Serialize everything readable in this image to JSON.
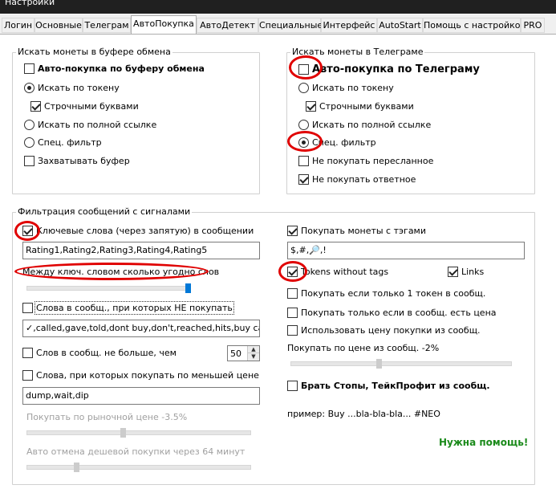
{
  "window": {
    "title": "Настройки"
  },
  "tabs": [
    {
      "label": "Логин"
    },
    {
      "label": "Основные"
    },
    {
      "label": "Телеграм"
    },
    {
      "label": "АвтоПокупка"
    },
    {
      "label": "АвтоДетект"
    },
    {
      "label": "Специальные"
    },
    {
      "label": "Интерфейс"
    },
    {
      "label": "AutoStart"
    },
    {
      "label": "Помощь с настройкой"
    },
    {
      "label": "PRO"
    }
  ],
  "active_tab": "АвтоПокупка",
  "clipboard_group": {
    "title": "Искать монеты в буфере обмена",
    "auto_buy": {
      "label": "Авто-покупка по буферу обмена",
      "checked": false
    },
    "by_token": {
      "label": "Искать по токену",
      "selected": true
    },
    "lowercase": {
      "label": "Строчными буквами",
      "checked": true
    },
    "by_link": {
      "label": "Искать по полной ссылке",
      "selected": false
    },
    "spec_filter": {
      "label": "Спец. фильтр",
      "selected": false
    },
    "capture": {
      "label": "Захватывать буфер",
      "checked": false
    }
  },
  "telegram_group": {
    "title": "Искать монеты в Телеграме",
    "auto_buy": {
      "label": "Авто-покупка по Телеграму",
      "checked": false
    },
    "by_token": {
      "label": "Искать по токену",
      "selected": false
    },
    "lowercase": {
      "label": "Строчными буквами",
      "checked": true
    },
    "by_link": {
      "label": "Искать по полной ссылке",
      "selected": false
    },
    "spec_filter": {
      "label": "Спец. фильтр",
      "selected": true
    },
    "no_forwarded": {
      "label": "Не покупать пересланное",
      "checked": false
    },
    "no_replies": {
      "label": "Не покупать ответное",
      "checked": true
    }
  },
  "filter_group": {
    "title": "Фильтрация сообщений с сигналами",
    "keywords": {
      "label": "Ключевые слова (через запятую) в сообщении",
      "checked": true,
      "value": "Rating1,Rating2,Rating3,Rating4,Rating5"
    },
    "between_label": "Между ключ. словом сколько угодно слов",
    "between_slider": {
      "value": 1.0
    },
    "exclude_words": {
      "label": "Слова в сообщ., при которых НЕ покупать",
      "checked": false,
      "value": "✓,called,gave,told,dont buy,don't,reached,hits,buy call,rep"
    },
    "max_words": {
      "label": "Слов в сообщ. не больше, чем",
      "checked": false,
      "value": "50"
    },
    "lower_price_words": {
      "label": "Слова, при которых покупать по меньшей цене",
      "checked": false,
      "value": "dump,wait,dip"
    },
    "market_price_label": "Покупать по рыночной цене -3.5%",
    "market_price_slider": {
      "value": 0.43
    },
    "auto_cancel_label": "Авто отмена дешевой покупки через 64 минут",
    "auto_cancel_slider": {
      "value": 0.22
    },
    "tags": {
      "label": "Покупать монеты с тэгами",
      "checked": true,
      "value": "$,#,🔎,!"
    },
    "tokens_without_tags": {
      "label": "Tokens without tags",
      "checked": true
    },
    "links": {
      "label": "Links",
      "checked": true
    },
    "only_one_token": {
      "label": "Покупать если только 1 токен в сообщ.",
      "checked": false
    },
    "only_with_price": {
      "label": "Покупать только если в сообщ. есть цена",
      "checked": false
    },
    "use_msg_price": {
      "label": "Использовать цену покупки из сообщ.",
      "checked": false
    },
    "msg_price_label": "Покупать по цене из сообщ. -2%",
    "msg_price_slider": {
      "value": 0.4
    },
    "stops": {
      "label": "Брать Стопы, ТейкПрофит из сообщ.",
      "checked": false
    },
    "example": "пример: Buy ...bla-bla-bla... #NEO",
    "help": "Нужна помощь!"
  },
  "colors": {
    "accent": "#0078d7",
    "annotation": "#e00000",
    "help": "#1a8a1a"
  }
}
